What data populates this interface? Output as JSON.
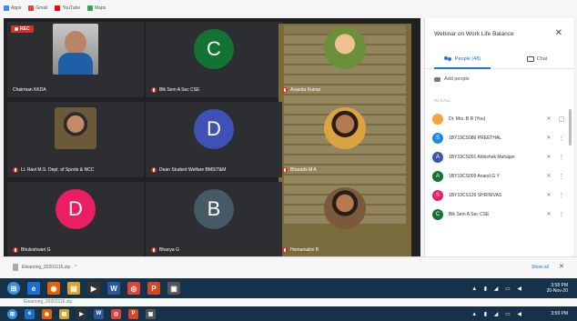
{
  "bookmarks": [
    {
      "label": "Apps",
      "color": "#4285f4"
    },
    {
      "label": "Gmail",
      "color": "#ea4335"
    },
    {
      "label": "YouTube",
      "color": "#ff0000"
    },
    {
      "label": "Maps",
      "color": "#34a853"
    }
  ],
  "meeting": {
    "rec_label": "REC",
    "tiles": [
      {
        "name": "Chairman KKDA",
        "kind": "photo"
      },
      {
        "name": "Blk Sem A Sec CSE",
        "kind": "avatar",
        "letter": "C",
        "color": "#137333"
      },
      {
        "name": "Ananda Kumar",
        "kind": "photo"
      },
      {
        "name": "Lt. Ravi M.S. Dept. of Sports & NCC",
        "kind": "photo"
      },
      {
        "name": "Dean Student Welfare BMSIT&M",
        "kind": "avatar",
        "letter": "D",
        "color": "#3f51b5"
      },
      {
        "name": "Bharathi M A",
        "kind": "photo"
      },
      {
        "name": "Bhuleshwari G",
        "kind": "avatar",
        "letter": "D",
        "color": "#e91e63"
      },
      {
        "name": "Bhavya G",
        "kind": "avatar",
        "letter": "B",
        "color": "#455a64"
      },
      {
        "name": "Hemamalini B",
        "kind": "photo"
      }
    ]
  },
  "panel": {
    "title": "Webinar on Work Life Balance",
    "tab_people": "People (48)",
    "tab_chat": "Chat",
    "add_people": "Add people",
    "section": "IN CALL",
    "participants": [
      {
        "name": "Dr. Mrs. B R (You)",
        "initial": "",
        "color": "#f2a33a"
      },
      {
        "name": "1BY19CS086 PREETHAL",
        "initial": "S",
        "color": "#1e88e5"
      },
      {
        "name": "1BY19CS001 Abhishek Mahajan",
        "initial": "A",
        "color": "#3f51b5"
      },
      {
        "name": "1BY19CS009 Anand G Y",
        "initial": "A",
        "color": "#137333"
      },
      {
        "name": "1BY19CS126 SHRINIVAS",
        "initial": "S",
        "color": "#e91e63"
      },
      {
        "name": "Blk Sem A Sec CSE",
        "initial": "C",
        "color": "#137333"
      }
    ]
  },
  "downloads": {
    "file": "Elearning_20201116.zip",
    "show_all": "Show all"
  },
  "taskbar": {
    "time": "3:58 PM",
    "date": "20-Nov-20",
    "time2": "3:59 PM"
  }
}
